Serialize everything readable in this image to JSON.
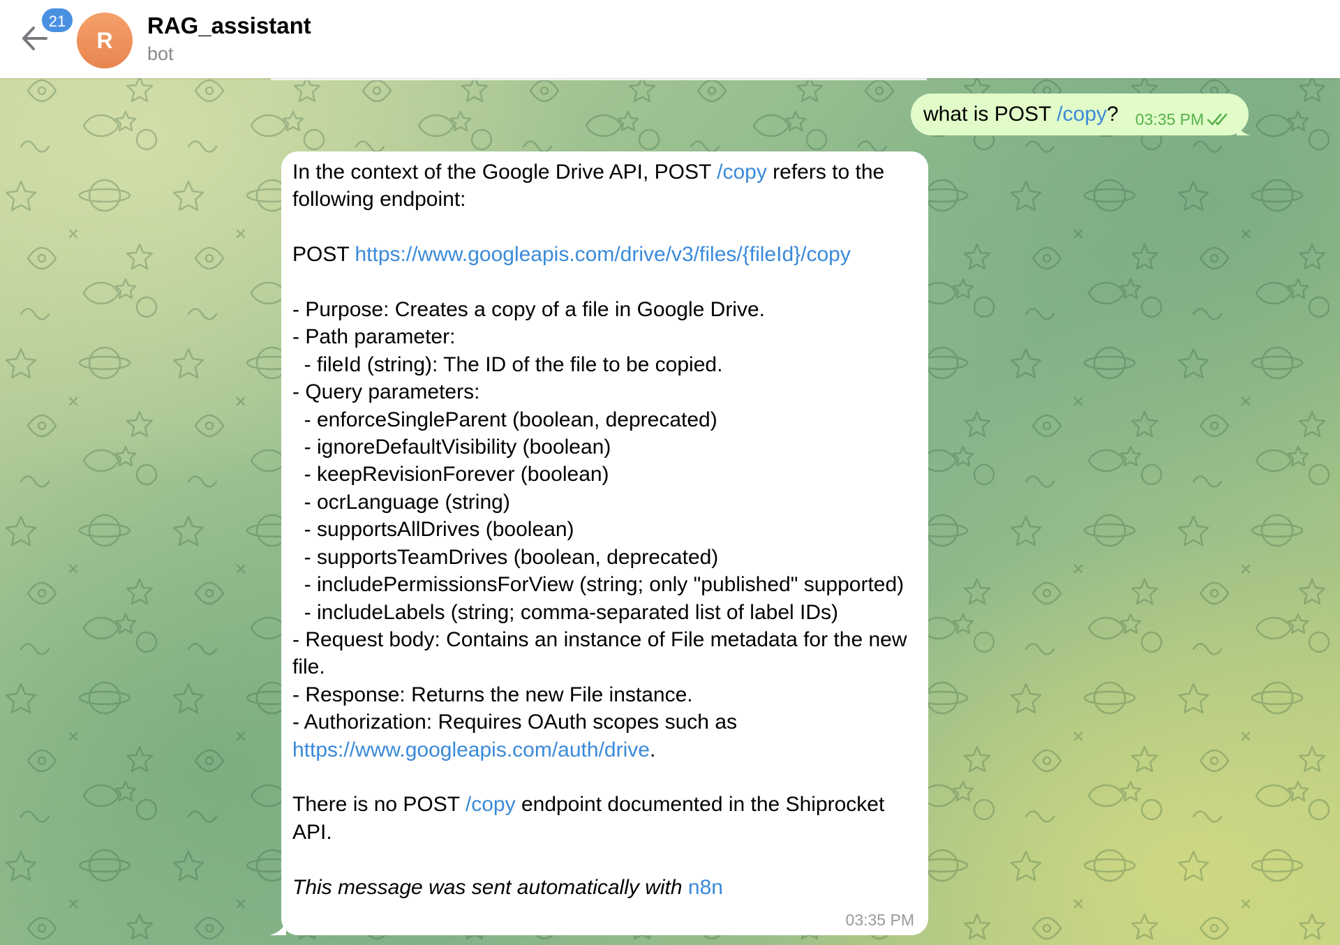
{
  "header": {
    "back_icon": "arrow-left-icon",
    "unread_count": "21",
    "avatar_letter": "R",
    "title": "RAG_assistant",
    "subtitle": "bot"
  },
  "outgoing": {
    "text_before": "what is POST ",
    "command": "/copy",
    "text_after": "?",
    "time": "03:35 PM",
    "status_icon": "double-check-icon"
  },
  "incoming": {
    "p1_a": "In the context of the Google Drive API, POST ",
    "p1_cmd": "/copy",
    "p1_b": " refers to the following endpoint:",
    "post_label": "POST ",
    "endpoint_url": "https://www.googleapis.com/drive/v3/files/{fileId}/copy",
    "lines": [
      "- Purpose: Creates a copy of a file in Google Drive.",
      "- Path parameter:",
      "  - fileId (string): The ID of the file to be copied.",
      "- Query parameters:",
      "  - enforceSingleParent (boolean, deprecated)",
      "  - ignoreDefaultVisibility (boolean)",
      "  - keepRevisionForever (boolean)",
      "  - ocrLanguage (string)",
      "  - supportsAllDrives (boolean)",
      "  - supportsTeamDrives (boolean, deprecated)",
      "  - includePermissionsForView (string; only \"published\" supported)",
      "  - includeLabels (string; comma-separated list of label IDs)",
      "- Request body: Contains an instance of File metadata for the new file.",
      "- Response: Returns the new File instance."
    ],
    "auth_a": "- Authorization: Requires OAuth scopes such as ",
    "auth_url": "https://www.googleapis.com/auth/drive",
    "auth_b": ".",
    "p3_a": "There is no POST ",
    "p3_cmd": "/copy",
    "p3_b": " endpoint documented in the Shiprocket API.",
    "footer_text": "This message was sent automatically with ",
    "footer_link": "n8n",
    "time": "03:35 PM"
  },
  "colors": {
    "link": "#3a8ad8",
    "outgoing_bubble": "#e1fcc8",
    "outgoing_meta": "#56b14c",
    "badge": "#4a90e2",
    "avatar": "#ee8e58"
  }
}
